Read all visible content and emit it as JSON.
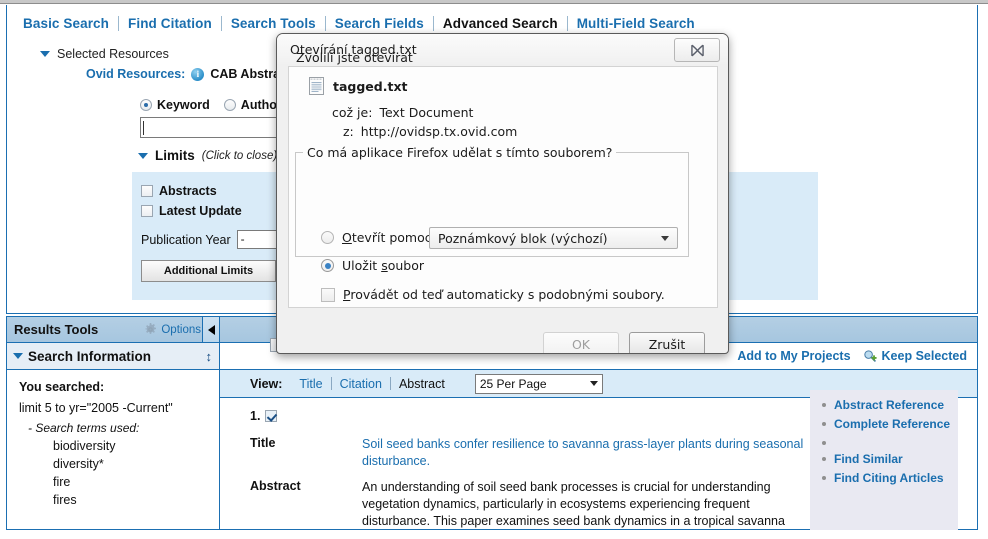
{
  "nav": {
    "tabs": [
      {
        "label": "Basic Search",
        "active": false
      },
      {
        "label": "Find Citation",
        "active": false
      },
      {
        "label": "Search Tools",
        "active": false
      },
      {
        "label": "Search Fields",
        "active": false
      },
      {
        "label": "Advanced Search",
        "active": true
      },
      {
        "label": "Multi-Field Search",
        "active": false
      }
    ]
  },
  "search": {
    "selected_resources_label": "Selected Resources",
    "ovid_resources_label": "Ovid Resources:",
    "ovid_resources_value": "CAB Abstracts",
    "mode_keyword": "Keyword",
    "mode_author": "Author",
    "query_value": "",
    "limits_title": "Limits",
    "limits_hint": "(Click to close)",
    "limits": {
      "abstracts": "Abstracts",
      "latest_update": "Latest Update",
      "publication_year_label": "Publication Year",
      "publication_year_value": "-",
      "additional_limits_button": "Additional Limits",
      "second_button": ""
    }
  },
  "results_tools": {
    "title": "Results Tools",
    "options_label": "Options",
    "search_information_title": "Search Information",
    "you_searched_label": "You searched:",
    "limit_line": "limit 5 to yr=\"2005 -Current\"",
    "search_terms_label": "- Search terms used:",
    "terms": [
      "biodiversity",
      "diversity*",
      "fire",
      "fires"
    ]
  },
  "results": {
    "actions": {
      "add_to_my_projects": "Add to My Projects",
      "keep_selected": "Keep Selected"
    },
    "view_label": "View:",
    "view_options": [
      {
        "label": "Title",
        "current": false
      },
      {
        "label": "Citation",
        "current": false
      },
      {
        "label": "Abstract",
        "current": true
      }
    ],
    "per_page": "25 Per Page",
    "record": {
      "number": "1.",
      "title_label": "Title",
      "title_value": "Soil seed banks confer resilience to savanna grass-layer plants during seasonal disturbance.",
      "abstract_label": "Abstract",
      "abstract_value": "An understanding of soil seed bank processes is crucial for understanding vegetation dynamics, particularly in ecosystems experiencing frequent disturbance. This paper examines seed bank dynamics in a tropical savanna"
    },
    "side_links_top": [
      "Abstract Reference",
      "Complete Reference"
    ],
    "side_links_bottom": [
      "Find Similar",
      "Find Citing Articles"
    ]
  },
  "dialog": {
    "title": "Otevírání tagged.txt",
    "intro": "Zvolili jste otevírat",
    "filename": "tagged.txt",
    "type_label": "což je:",
    "type_value": "Text Document",
    "from_label": "z:",
    "from_value": "http://ovidsp.tx.ovid.com",
    "group_legend": "Co má aplikace Firefox udělat s tímto souborem?",
    "open_with_label": "Otevřít pomocí",
    "open_with_value": "Poznámkový blok (výchozí)",
    "save_file_label": "Uložit soubor",
    "auto_label": "Provádět od teď automaticky s podobnými soubory.",
    "ok_label": "OK",
    "cancel_label": "Zrušit"
  },
  "colors": {
    "accent_blue": "#1a6eae",
    "panel_border": "#1b6fb2",
    "limits_bg": "#d9ebf8",
    "header_bg": "#a6c6df"
  }
}
